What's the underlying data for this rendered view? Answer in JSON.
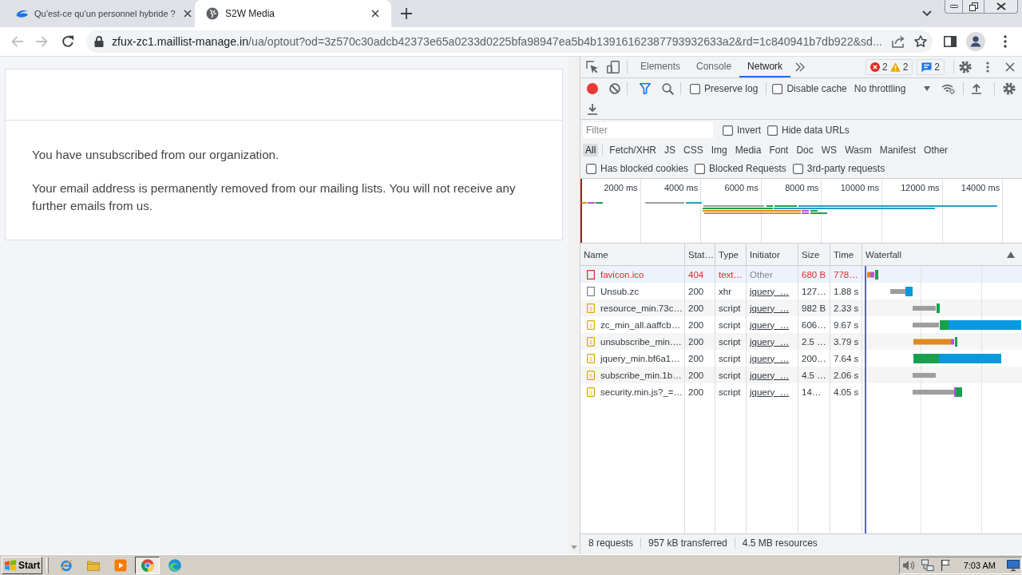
{
  "browser": {
    "tabs": [
      {
        "kind": "logo",
        "title": "Qu’est-ce qu’un personnel hybride ?",
        "selected": false
      },
      {
        "kind": "globe",
        "title": "S2W Media",
        "selected": true
      }
    ],
    "navigation": {
      "back_disabled": true,
      "forward_disabled": true
    },
    "address_bar": {
      "host": "zfux-zc1.maillist-manage.in",
      "path": "/ua/optout?od=3z570c30adcb42373e65a0233d0225bfa98947ea5b4b13916162387793932633a2&rd=1c840941b7db922&sd..."
    }
  },
  "page": {
    "paragraphs": [
      "You have unsubscribed from our organization.",
      "Your email address is permanently removed from our mailing lists. You will not receive any further emails from us."
    ]
  },
  "devtools": {
    "tabs": [
      {
        "label": "Elements",
        "selected": false
      },
      {
        "label": "Console",
        "selected": false
      },
      {
        "label": "Network",
        "selected": true
      }
    ],
    "issue_counts": {
      "errors": "2",
      "warnings": "2",
      "messages": "2"
    },
    "network_toolbar": {
      "recording": true,
      "filter_active": true,
      "options": [
        {
          "label": "Preserve log",
          "checked": false
        },
        {
          "label": "Disable cache",
          "checked": false
        }
      ],
      "throttling": "No throttling"
    },
    "filter_bar": {
      "placeholder": "Filter",
      "options": [
        {
          "label": "Invert",
          "checked": false
        },
        {
          "label": "Hide data URLs",
          "checked": false
        }
      ],
      "types": [
        {
          "label": "All",
          "selected": true
        },
        {
          "label": "Fetch/XHR",
          "selected": false
        },
        {
          "label": "JS",
          "selected": false
        },
        {
          "label": "CSS",
          "selected": false
        },
        {
          "label": "Img",
          "selected": false
        },
        {
          "label": "Media",
          "selected": false
        },
        {
          "label": "Font",
          "selected": false
        },
        {
          "label": "Doc",
          "selected": false
        },
        {
          "label": "WS",
          "selected": false
        },
        {
          "label": "Wasm",
          "selected": false
        },
        {
          "label": "Manifest",
          "selected": false
        },
        {
          "label": "Other",
          "selected": false
        }
      ],
      "extra_options": [
        {
          "label": "Has blocked cookies",
          "checked": false
        },
        {
          "label": "Blocked Requests",
          "checked": false
        },
        {
          "label": "3rd-party requests",
          "checked": false
        }
      ]
    },
    "overview": {
      "ticks": [
        "2000 ms",
        "4000 ms",
        "6000 ms",
        "8000 ms",
        "10000 ms",
        "12000 ms",
        "14000 ms"
      ]
    },
    "table": {
      "columns": [
        "Name",
        "Stat…",
        "Type",
        "Initiator",
        "Size",
        "Time",
        "Waterfall"
      ],
      "rows": [
        {
          "kind": "document",
          "name": "favicon.ico",
          "status": "404",
          "type": "text…",
          "initiator": "Other",
          "initiator_link": false,
          "size": "680 B",
          "time": "778…",
          "failed": true,
          "highlighted": true
        },
        {
          "kind": "document",
          "name": "Unsub.zc",
          "status": "200",
          "type": "xhr",
          "initiator": "jquery_…",
          "initiator_link": true,
          "size": "127…",
          "time": "1.88 s",
          "failed": false,
          "highlighted": false
        },
        {
          "kind": "script",
          "name": "resource_min.73c…",
          "status": "200",
          "type": "script",
          "initiator": "jquery_…",
          "initiator_link": true,
          "size": "982 B",
          "time": "2.33 s",
          "failed": false,
          "highlighted": false
        },
        {
          "kind": "script",
          "name": "zc_min_all.aaffcb…",
          "status": "200",
          "type": "script",
          "initiator": "jquery_…",
          "initiator_link": true,
          "size": "606…",
          "time": "9.67 s",
          "failed": false,
          "highlighted": false
        },
        {
          "kind": "script",
          "name": "unsubscribe_min.…",
          "status": "200",
          "type": "script",
          "initiator": "jquery_…",
          "initiator_link": true,
          "size": "2.5 …",
          "time": "3.79 s",
          "failed": false,
          "highlighted": false
        },
        {
          "kind": "script",
          "name": "jquery_min.bf6a1…",
          "status": "200",
          "type": "script",
          "initiator": "jquery_…",
          "initiator_link": true,
          "size": "200…",
          "time": "7.64 s",
          "failed": false,
          "highlighted": false
        },
        {
          "kind": "script",
          "name": "subscribe_min.1b…",
          "status": "200",
          "type": "script",
          "initiator": "jquery_…",
          "initiator_link": true,
          "size": "4.5 …",
          "time": "2.06 s",
          "failed": false,
          "highlighted": false
        },
        {
          "kind": "script",
          "name": "security.min.js?_=…",
          "status": "200",
          "type": "script",
          "initiator": "jquery_…",
          "initiator_link": true,
          "size": "14…",
          "time": "4.05 s",
          "failed": false,
          "highlighted": false
        }
      ]
    },
    "status_bar": [
      "8 requests",
      "957 kB transferred",
      "4.5 MB resources"
    ]
  },
  "taskbar": {
    "start_label": "Start",
    "apps": [
      {
        "kind": "e-logo",
        "active": false
      },
      {
        "kind": "folder",
        "active": false
      },
      {
        "kind": "media",
        "active": false
      },
      {
        "kind": "chrome",
        "active": true
      },
      {
        "kind": "edge",
        "active": false
      }
    ],
    "tray": [
      {
        "kind": "speaker"
      },
      {
        "kind": "network"
      },
      {
        "kind": "flag"
      }
    ],
    "clock": "7:03 AM"
  }
}
